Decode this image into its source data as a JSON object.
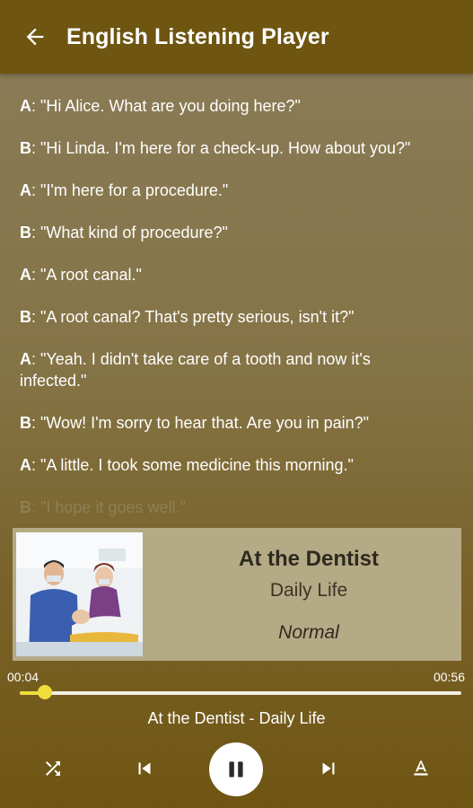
{
  "app": {
    "title": "English Listening Player"
  },
  "transcript": [
    {
      "speaker": "A",
      "text": ":  \"Hi Alice.  What are you doing here?\""
    },
    {
      "speaker": "B",
      "text": ":  \"Hi Linda.  I'm here for a check-up.  How about you?\""
    },
    {
      "speaker": "A",
      "text": ":  \"I'm here for a procedure.\""
    },
    {
      "speaker": "B",
      "text": ":  \"What kind of procedure?\""
    },
    {
      "speaker": "A",
      "text": ":  \"A root canal.\""
    },
    {
      "speaker": "B",
      "text": ":  \"A root canal?  That's pretty serious, isn't it?\""
    },
    {
      "speaker": "A",
      "text": ":  \"Yeah.  I didn't take care of a tooth and now it's infected.\""
    },
    {
      "speaker": "B",
      "text": ":  \"Wow!  I'm sorry to hear that.  Are you in pain?\""
    },
    {
      "speaker": "A",
      "text": ":  \"A little.  I took some medicine this morning.\""
    },
    {
      "speaker": "B",
      "text": ":  \"I hope it goes well.\""
    }
  ],
  "lesson": {
    "title": "At the Dentist",
    "category": "Daily Life",
    "level": "Normal"
  },
  "player": {
    "current_time": "00:04",
    "duration": "00:56",
    "progress": 0.057,
    "now_playing": "At the Dentist - Daily Life"
  },
  "icons": {
    "back": "arrow-left-icon",
    "shuffle": "shuffle-icon",
    "previous": "skip-previous-icon",
    "pause": "pause-icon",
    "next": "skip-next-icon",
    "text_size": "text-format-icon"
  },
  "colors": {
    "appbar": "#6e5510",
    "accent": "#f0dd3c",
    "card": "#b5aa86"
  }
}
